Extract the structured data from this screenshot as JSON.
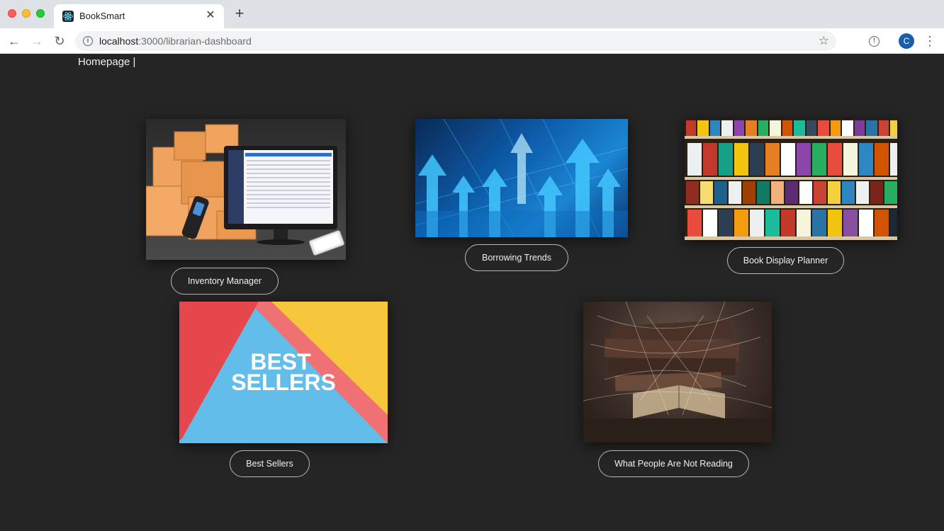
{
  "browser": {
    "tab_title": "BookSmart",
    "tab_close": "✕",
    "new_tab": "+",
    "url_host": "localhost",
    "url_path": ":3000/librarian-dashboard",
    "avatar_letter": "C"
  },
  "navbar": {
    "homepage_link": "Homepage",
    "separator": " |"
  },
  "cards": {
    "inventory": {
      "label": "Inventory Manager",
      "image_icon": "inventory-scanner-image"
    },
    "trends": {
      "label": "Borrowing Trends",
      "image_icon": "rising-arrows-image"
    },
    "display": {
      "label": "Book Display Planner",
      "image_icon": "bookshelf-image"
    },
    "best": {
      "label": "Best Sellers",
      "image_text_line1": "BEST",
      "image_text_line2": "SELLERS"
    },
    "notreading": {
      "label": "What People Are Not Reading",
      "image_icon": "cobweb-books-image"
    }
  },
  "colors": {
    "page_background": "#252525",
    "best_red": "#e5474c",
    "best_yellow": "#f6c63b",
    "best_blue": "#62bde8",
    "best_stripe": "#f07173"
  }
}
